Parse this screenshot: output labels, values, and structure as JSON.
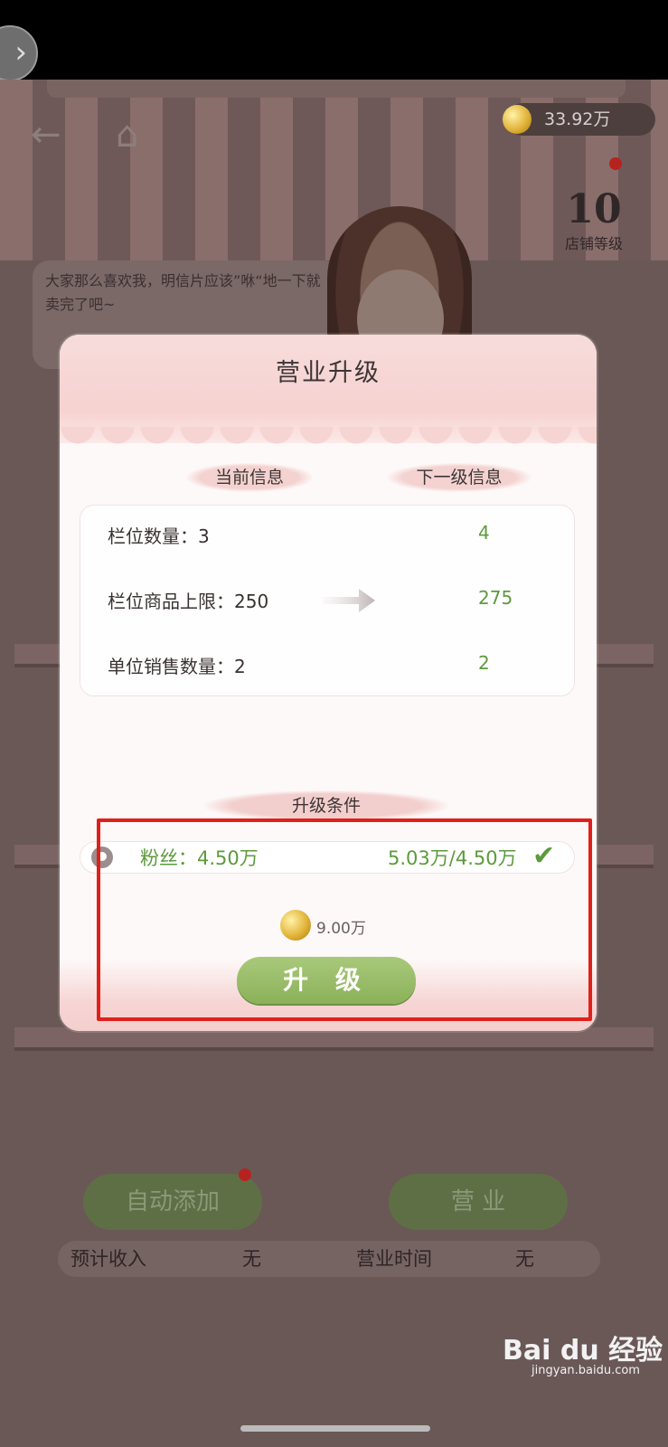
{
  "background": {
    "coins_display": "33.92万",
    "shop_level": "10",
    "shop_level_label": "店铺等级",
    "speech_text": "大家那么喜欢我，明信片应该”咻“地一下就卖完了吧~",
    "auto_add_label": "自动添加",
    "business_label": "营  业",
    "footer": {
      "income_label": "预计收入",
      "income_value": "无",
      "time_label": "营业时间",
      "time_value": "无"
    }
  },
  "modal": {
    "title": "营业升级",
    "current_header": "当前信息",
    "next_header": "下一级信息",
    "rows": [
      {
        "label": "栏位数量：",
        "current": "3",
        "next": "4"
      },
      {
        "label": "栏位商品上限：",
        "current": "250",
        "next": "275"
      },
      {
        "label": "单位销售数量：",
        "current": "2",
        "next": "2"
      }
    ],
    "conditions_header": "升级条件",
    "condition": {
      "label": "粉丝：4.50万",
      "progress": "5.03万/4.50万",
      "met": true
    },
    "cost": "9.00万",
    "upgrade_button": "升 级"
  },
  "watermark": {
    "logo": "Bai du 经验",
    "url": "jingyan.baidu.com"
  },
  "colors": {
    "accent_green": "#5c9a3c",
    "button_green": "#8bb15a",
    "highlight_red": "#e0201b",
    "modal_pink": "#f6d2d0"
  },
  "icons": [
    "back-arrow-icon",
    "home-icon",
    "coin-icon",
    "fans-icon",
    "check-icon",
    "right-arrow-icon"
  ]
}
